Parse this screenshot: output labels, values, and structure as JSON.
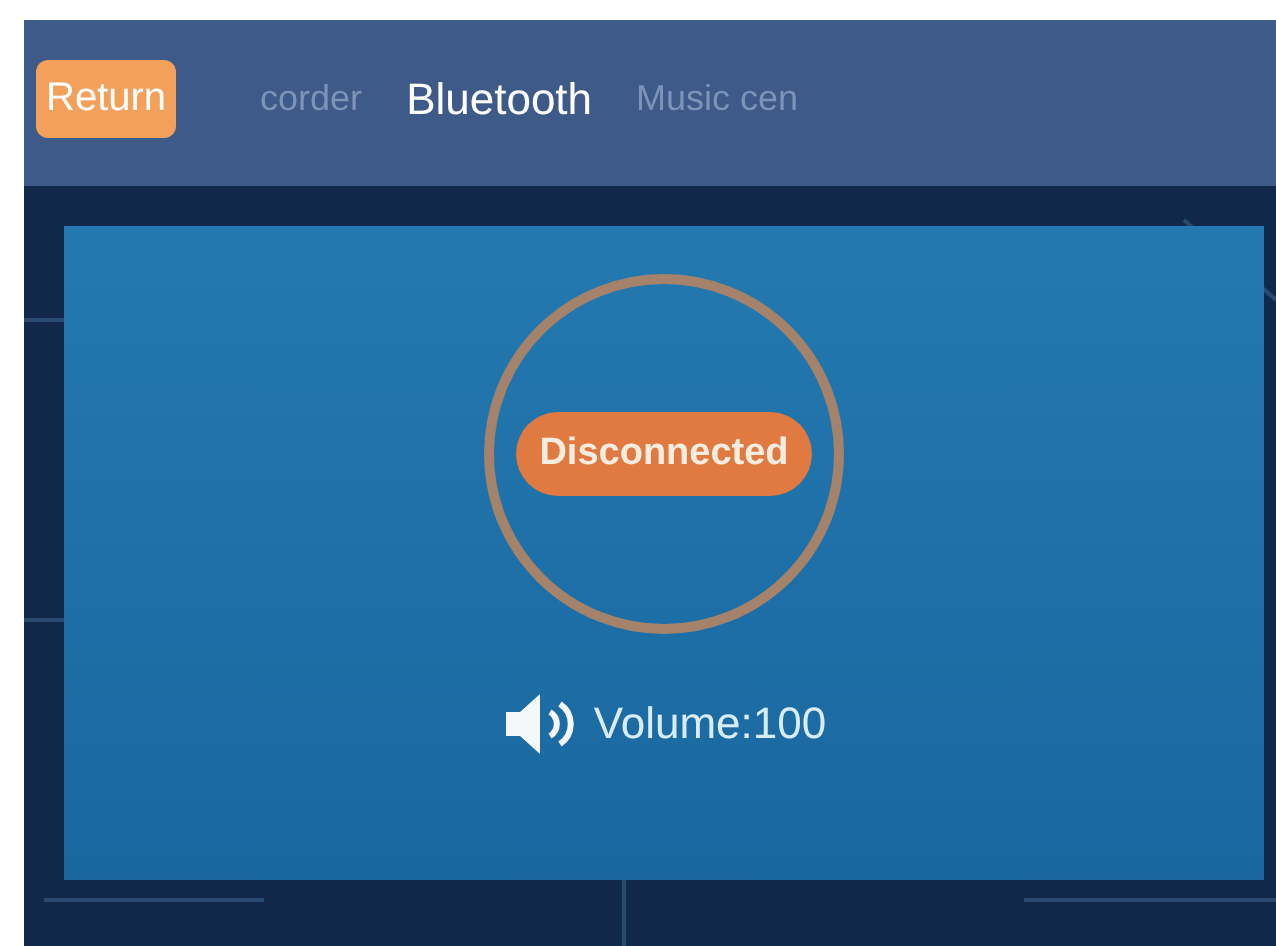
{
  "return_button": {
    "label": "Return"
  },
  "tabs": [
    {
      "label": "corder",
      "selected": false
    },
    {
      "label": "Bluetooth",
      "selected": true
    },
    {
      "label": "Music cen",
      "selected": false
    }
  ],
  "status": {
    "label": "Disconnected"
  },
  "volume": {
    "label": "Volume:100"
  }
}
